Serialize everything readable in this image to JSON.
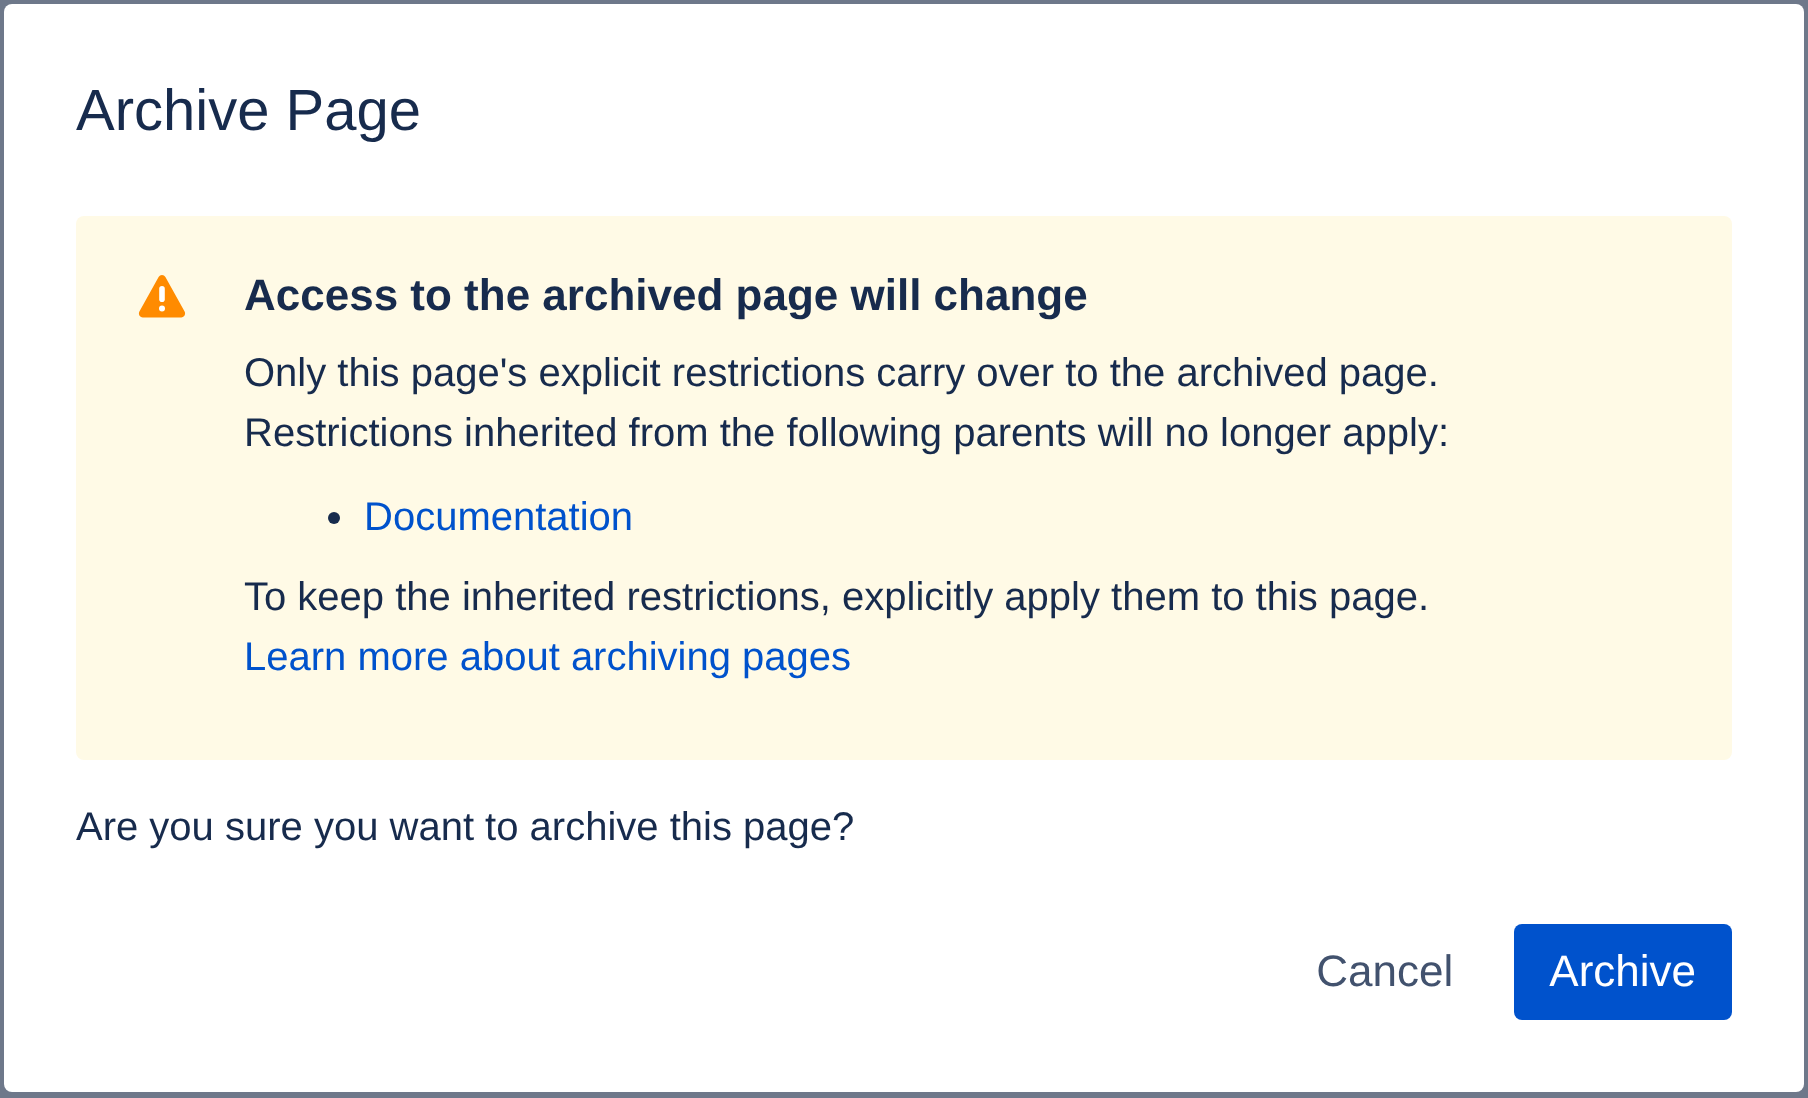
{
  "dialog": {
    "title": "Archive Page",
    "warning": {
      "heading": "Access to the archived page will change",
      "paragraphs": [
        "Only this page's explicit restrictions carry over to the archived page.",
        "Restrictions inherited from the following parents will no longer apply:"
      ],
      "parents": [
        "Documentation"
      ],
      "footer": "To keep the inherited restrictions, explicitly apply them to this page.",
      "link": "Learn more about archiving pages"
    },
    "question": "Are you sure you want to archive this page?",
    "buttons": [
      {
        "label": "Cancel",
        "kind": "subtle"
      },
      {
        "label": "Archive",
        "kind": "primary"
      }
    ]
  }
}
